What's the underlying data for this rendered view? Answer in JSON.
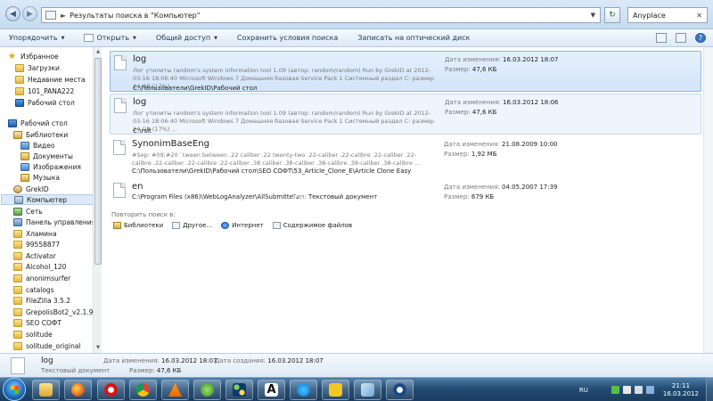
{
  "address": {
    "separator": "►",
    "path": "Результаты поиска в \"Компьютер\"",
    "search_value": "Anyplace",
    "clear_glyph": "✕"
  },
  "toolbar": {
    "organize": "Упорядочить",
    "open": "Открыть",
    "share": "Общий доступ",
    "save_search": "Сохранить условия поиска",
    "burn": "Записать на оптический диск"
  },
  "nav": {
    "favorites": "Избранное",
    "downloads": "Загрузки",
    "recent": "Недавние места",
    "panasonic": "101_PANA222",
    "desktop_fav": "Рабочий стол",
    "desktop": "Рабочий стол",
    "libraries": "Библиотеки",
    "video": "Видео",
    "documents": "Документы",
    "images": "Изображения",
    "music": "Музыка",
    "grekid": "GrekID",
    "computer": "Компьютер",
    "network": "Сеть",
    "control_panel": "Панель управления",
    "folders": [
      "Хламина",
      "99558877",
      "Activator",
      "Alcohol_120",
      "anonimsurfer",
      "catalogs",
      "FileZilla 3.5.2",
      "GrepolisBot2_v2.1.9.1",
      "SEO СОФТ",
      "solitude",
      "solitude_original",
      "Unlaf de29"
    ]
  },
  "results": [
    {
      "name": "log",
      "desc": "Лог утилиты random's system information tool 1.09 (автор: random/random) Run by GrekID at 2012-03-16 18:06:40 Microsoft Windows 7 Домашняя базовая Service Pack 1 Системный раздел C: размер 24 GB (17%) ...",
      "path": "C:\\Пользователи\\GrekID\\Рабочий стол",
      "date_label": "Дата изменения:",
      "date": "16.03.2012 18:07",
      "size_label": "Размер:",
      "size": "47,6 КБ"
    },
    {
      "name": "log",
      "desc": "Лог утилиты random's system information tool 1.09 (автор: random/random) Run by GrekID at 2012-03-16 18:06:40 Microsoft Windows 7 Домашняя базовая Service Pack 1 Системный раздел C: размер 24 GB (17%) ...",
      "path": "C:\\rsit",
      "date_label": "Дата изменения:",
      "date": "16.03.2012 18:06",
      "size_label": "Размер:",
      "size": "47,6 КБ"
    },
    {
      "name": "SynonimBaseEng",
      "desc": "#Sep: #09;#20 `tween between .22 caliber .22 twenty-two .22-caliber .22-calibre .22-caliber .22-calibre .22-caliber .22-calibre .22-caliber .38 caliber .38-caliber .38-calibre .38-caliber .38-calibre ...",
      "path": "C:\\Пользователи\\GrekID\\Рабочий стол\\SEO СОФТ\\53_Article_Clone_E\\Article Clone Easy",
      "date_label": "Дата изменения:",
      "date": "21.08.2009 10:00",
      "size_label": "Размер:",
      "size": "1,92 МБ"
    },
    {
      "name": "en",
      "path": "C:\\Program Files (x86)\\WebLogAnalyzer\\AllSubmitte...",
      "type_label": "Тип:",
      "type": "Текстовый документ",
      "date_label": "Дата изменения:",
      "date": "04.05.2007 17:39",
      "size_label": "Размер:",
      "size": "679 КБ"
    }
  ],
  "search_again": {
    "label": "Повторить поиск в:",
    "libraries": "Библиотеки",
    "other": "Другое...",
    "internet": "Интернет",
    "file_contents": "Содержимое файлов"
  },
  "details": {
    "name": "log",
    "type": "Текстовый документ",
    "modified_label": "Дата изменения:",
    "modified": "16.03.2012 18:07",
    "size_label": "Размер:",
    "size": "47,6 КБ",
    "created_label": "Дата создания:",
    "created": "16.03.2012 18:07"
  },
  "taskbar": {
    "lang": "RU",
    "time": "21:11",
    "date": "16.03.2012"
  }
}
